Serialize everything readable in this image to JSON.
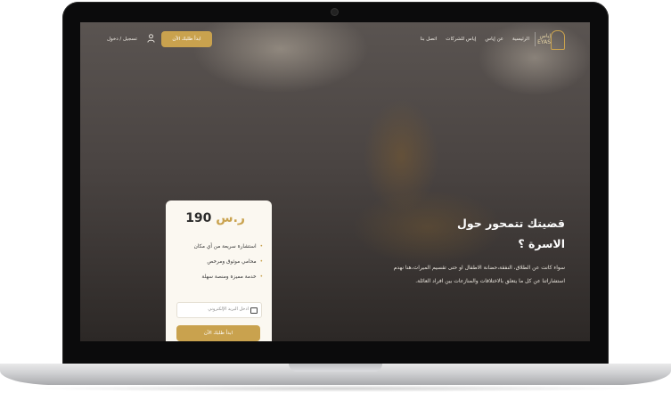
{
  "header": {
    "logo_text": "إياس\nEYAS",
    "menu": [
      "الرئيسية",
      "عن إياس",
      "إياس للشركات",
      "اتصل بنا"
    ],
    "cta_label": "ابدأ طلبك الآن",
    "login_text": "تسجيل / دخول"
  },
  "hero": {
    "title_line1": "قضيتك تتمحور حول",
    "title_line2": "الاسرة ؟",
    "description": "سواء كانت عن الطلاق، النفقة،حضانة الاطفال او حتى تقسيم الميراث،هنا نهدم استشاراتنا عن كل ما يتعلق بالاختلافات والمنازعات بين افراد العائلة."
  },
  "card": {
    "price_value": "190",
    "price_currency": "ر.س",
    "features": [
      "استشارة سريعة من أي مكان",
      "محامي موثوق ومرخص",
      "خدمة مميزة ومنصة سهلة"
    ],
    "input_placeholder": "ادخل البريد الإلكتروني",
    "button_label": "ابدأ طلبك الآن"
  },
  "colors": {
    "accent": "#c9a24e",
    "card_bg": "#fbf8f1"
  }
}
